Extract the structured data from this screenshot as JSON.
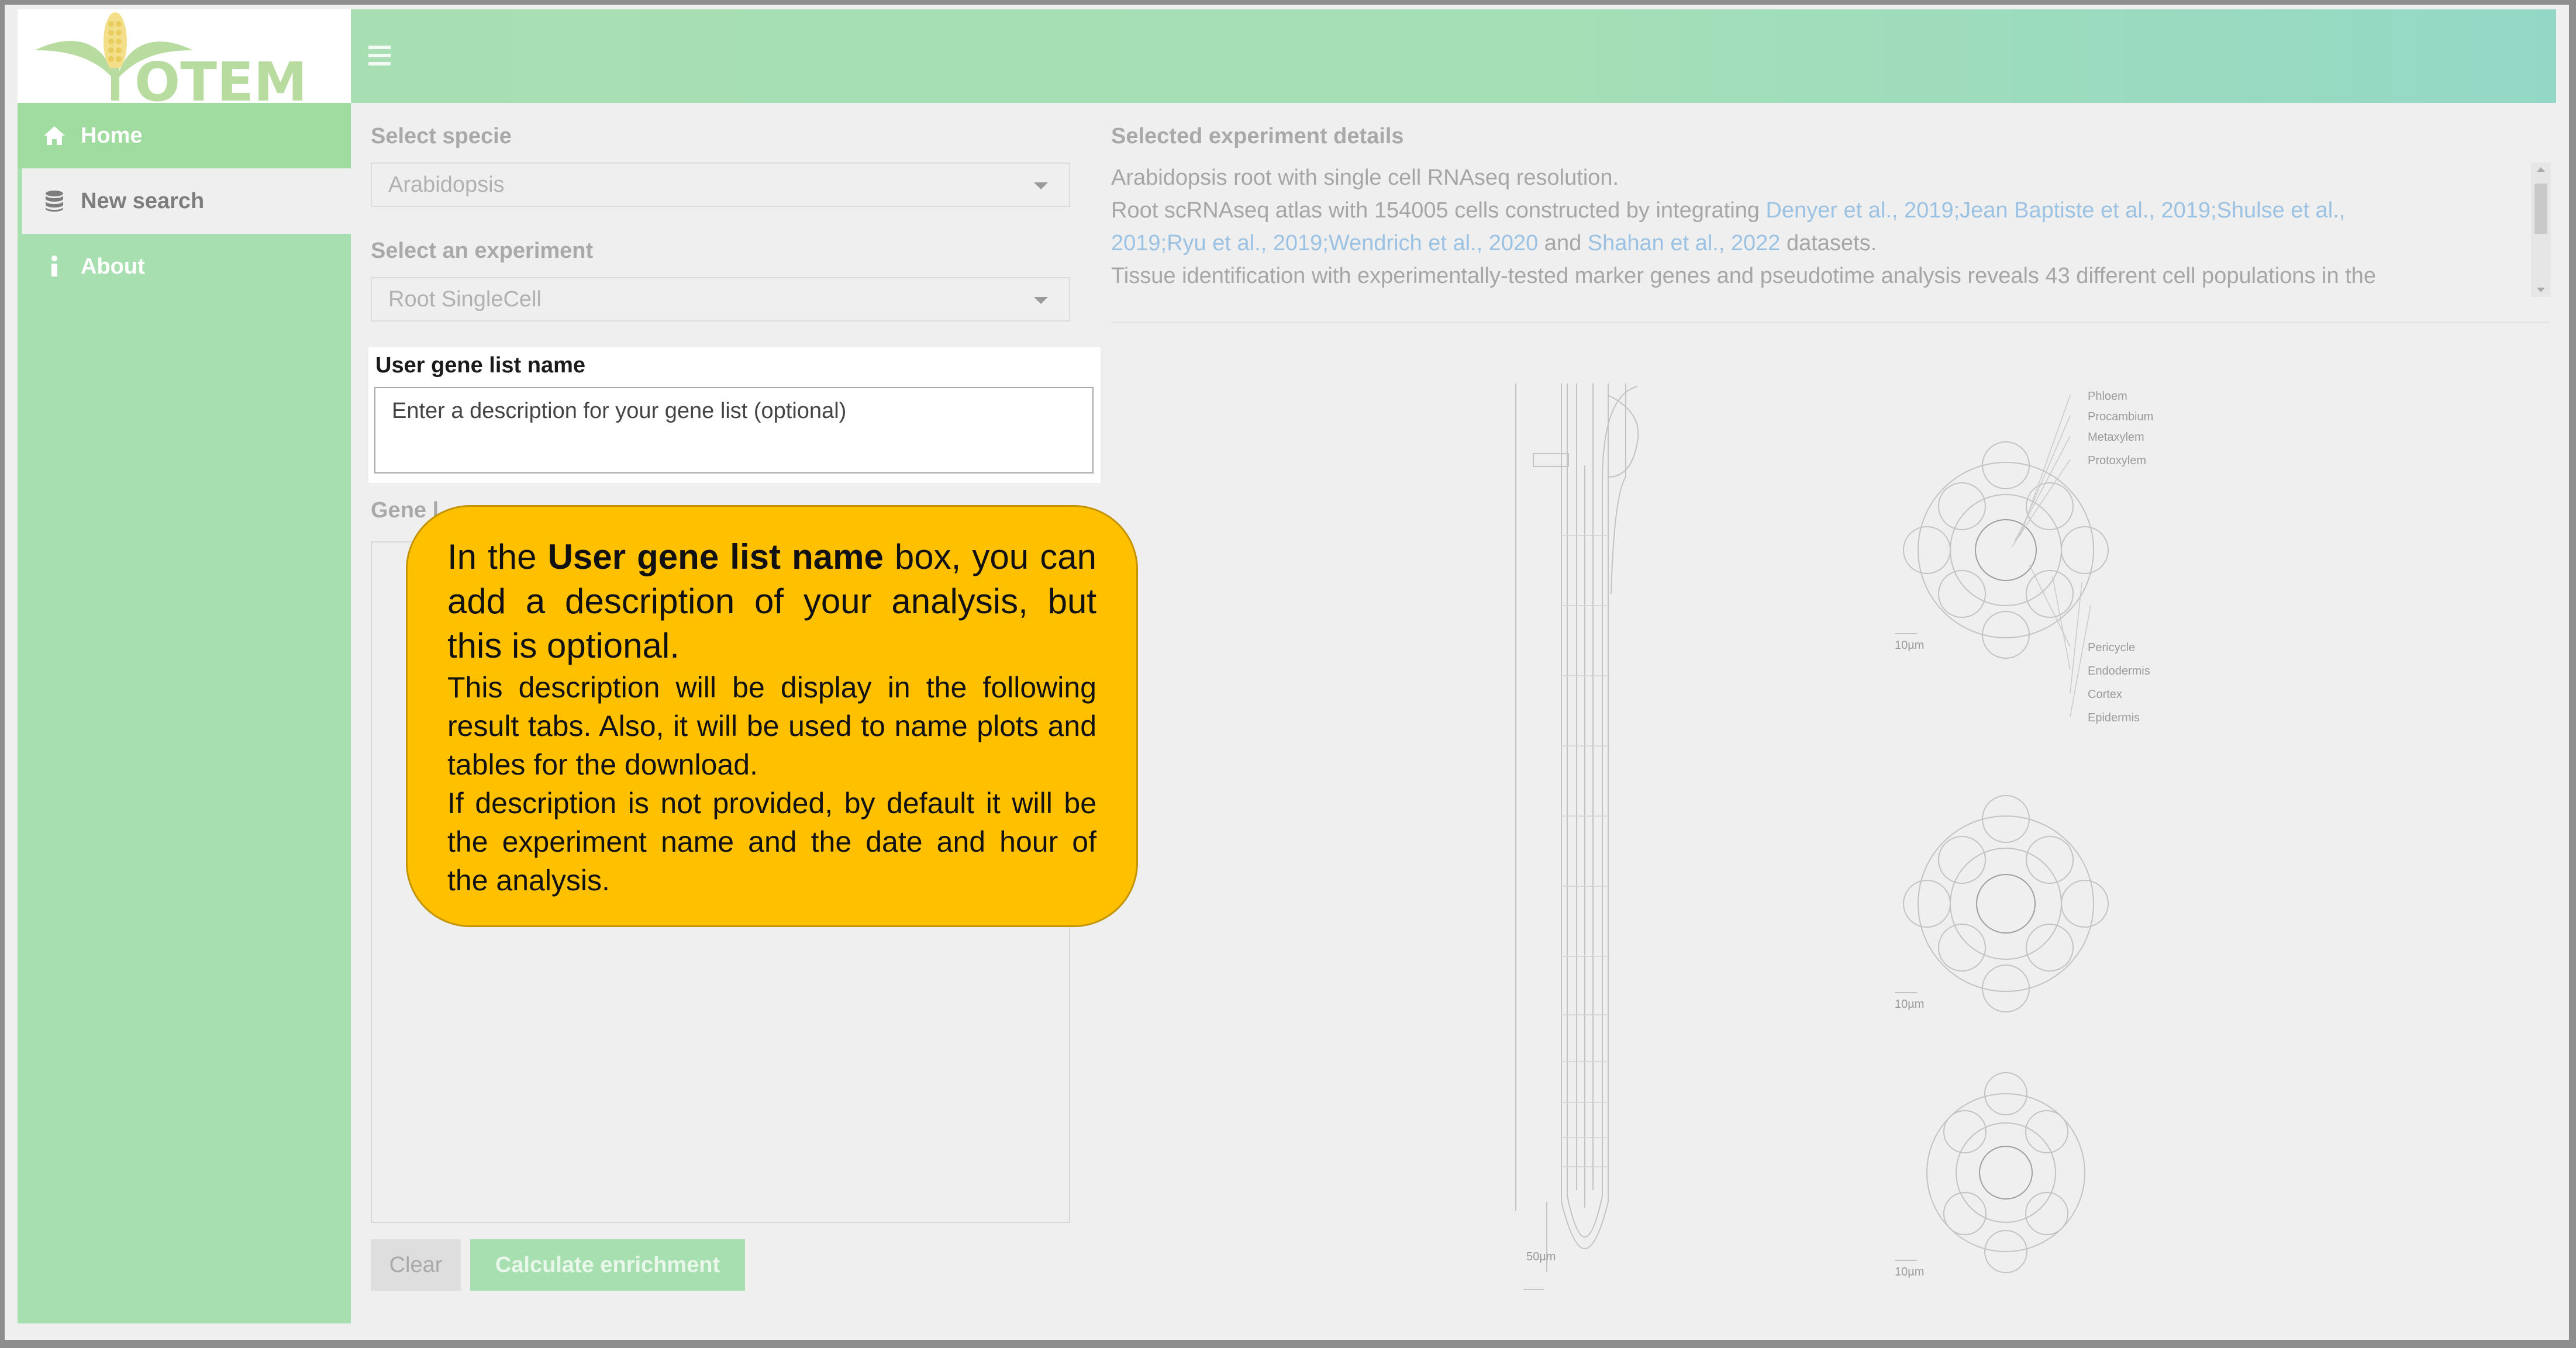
{
  "brand": {
    "logo_text": "OTEM"
  },
  "sidebar": {
    "items": [
      {
        "label": "Home",
        "icon": "home-icon"
      },
      {
        "label": "New search",
        "icon": "database-icon"
      },
      {
        "label": "About",
        "icon": "info-icon"
      }
    ]
  },
  "form": {
    "species_label": "Select specie",
    "species_value": "Arabidopsis",
    "experiment_label": "Select an experiment",
    "experiment_value": "Root SingleCell",
    "gene_list_name_label": "User gene list name",
    "gene_list_name_placeholder": "Enter a description for your gene list (optional)",
    "gene_list_label_partial": "Gene l",
    "clear_button": "Clear",
    "calculate_button": "Calculate enrichment"
  },
  "details": {
    "title": "Selected experiment details",
    "line1": "Arabidopsis root with single cell RNAseq resolution.",
    "line2_prefix": "Root scRNAseq atlas with 154005 cells constructed by integrating ",
    "link_denyer": "Denyer et al., 2019",
    "sep1": ";",
    "link_jean": "Jean Baptiste et al., 2019",
    "sep2": ";",
    "link_shulse_a": "Shulse et al.,",
    "link_shulse_b": "2019",
    "sep3": ";",
    "link_ryu": "Ryu et al., 2019",
    "sep4": ";",
    "link_wendrich": "Wendrich et al., 2020",
    "and_text": " and ",
    "link_shahan": "Shahan et al., 2022",
    "datasets_text": " datasets.",
    "line4": "Tissue identification with experimentally-tested marker genes and pseudotime analysis reveals 43 different cell populations in the"
  },
  "figure": {
    "labels_top": [
      "Phloem",
      "Procambium",
      "Metaxylem",
      "Protoxylem"
    ],
    "labels_bottom": [
      "Pericycle",
      "Endodermis",
      "Cortex",
      "Epidermis"
    ],
    "scale_long": "50µm",
    "scale_short": "10µm"
  },
  "callout": {
    "seg1": "In the ",
    "bold": "User gene list name",
    "seg2": " box, you can add a description of your analysis, but this is optional.",
    "para2": "This description will be display in the following result tabs. Also, it will be used to name plots and tables for the download.",
    "para3": "If description is not provided, by default it will be the experiment name and the date and hour of the analysis."
  },
  "colors": {
    "accent_green": "#a8dfb0",
    "callout_yellow": "#ffc000",
    "link_blue": "#9bc2e2"
  }
}
